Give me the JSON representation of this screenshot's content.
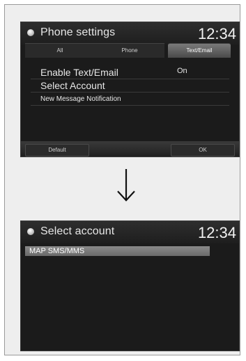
{
  "screen1": {
    "title": "Phone settings",
    "clock": "12:34",
    "tabs": [
      "All",
      "Phone",
      "Text/Email"
    ],
    "active_tab": "Text/Email",
    "menu": [
      {
        "label": "Enable Text/Email",
        "value": "On"
      },
      {
        "label": "Select Account",
        "value": ""
      },
      {
        "label": "New Message Notification",
        "value": ""
      }
    ],
    "footer": {
      "default_label": "Default",
      "ok_label": "OK"
    }
  },
  "arrow_icon": "down-arrow-icon",
  "screen2": {
    "title": "Select account",
    "clock": "12:34",
    "accounts": [
      "MAP SMS/MMS"
    ]
  },
  "colors": {
    "screen_bg": "#1b1b1b",
    "text": "#e8e8e8",
    "highlight": "#7a7a7a",
    "frame": "#eeeeee"
  }
}
